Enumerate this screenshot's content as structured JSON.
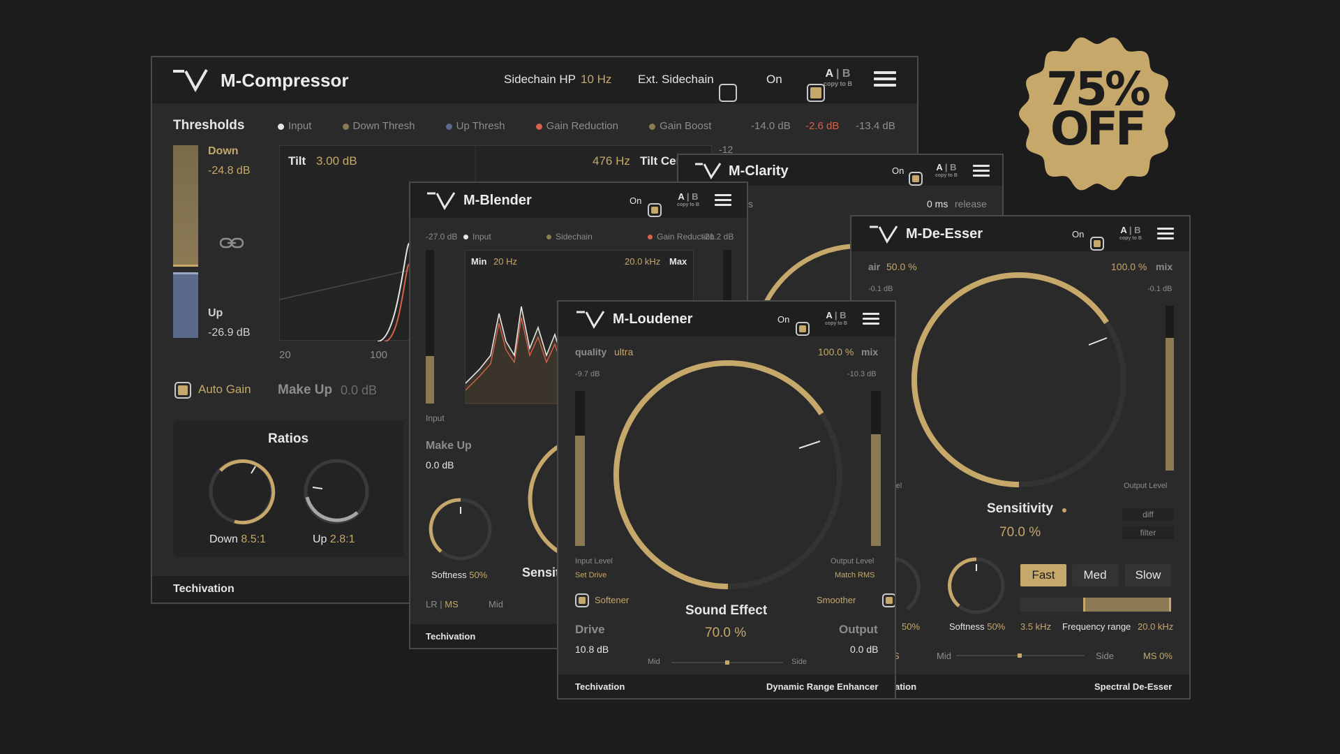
{
  "colors": {
    "accent": "#c6a86b",
    "background": "#1c1c1c",
    "panel": "#2a2a2a",
    "gain_reduction": "#d7624c",
    "up_threshold": "#5a6a8a"
  },
  "badge": {
    "line1": "75%",
    "line2": "OFF"
  },
  "compressor": {
    "title": "M-Compressor",
    "sidechain_hp_label": "Sidechain HP",
    "sidechain_hp_value": "10 Hz",
    "ext_sidechain_label": "Ext. Sidechain",
    "on_label": "On",
    "ab": {
      "a": "A",
      "sep": "|",
      "b": "B",
      "copy": "copy to B"
    },
    "thresholds_label": "Thresholds",
    "legend": {
      "input": "Input",
      "down_thresh": "Down Thresh",
      "up_thresh": "Up Thresh",
      "gain_reduction": "Gain Reduction",
      "gain_boost": "Gain Boost"
    },
    "readouts": {
      "v1": "-14.0 dB",
      "v2": "-2.6 dB",
      "v3": "-13.4 dB"
    },
    "down_label": "Down",
    "down_value": "-24.8 dB",
    "up_label": "Up",
    "up_value": "-26.9 dB",
    "tilt_label": "Tilt",
    "tilt_value": "3.00 dB",
    "tilt_freq": "476 Hz",
    "tilt_center": "Tilt Cen",
    "axis_minus12": "-12",
    "axis_20": "20",
    "axis_100": "100",
    "auto_gain": "Auto Gain",
    "make_up_label": "Make Up",
    "make_up_value": "0.0 dB",
    "ratios_label": "Ratios",
    "ratio_down_label": "Down",
    "ratio_down_value": "8.5:1",
    "ratio_up_label": "Up",
    "ratio_up_value": "2.8:1",
    "footer": "Techivation"
  },
  "blender": {
    "title": "M-Blender",
    "on_label": "On",
    "ab": {
      "a": "A",
      "sep": "|",
      "b": "B",
      "copy": "copy to B"
    },
    "left_db": "-27.0 dB",
    "legend_input": "Input",
    "legend_sidechain": "Sidechain",
    "legend_gain_reduction": "Gain Reduction",
    "right_db": "-21.2 dB",
    "min_label": "Min",
    "min_value": "20 Hz",
    "max_value": "20.0 kHz",
    "max_label": "Max",
    "input_label": "Input",
    "make_up_label": "Make Up",
    "make_up_value": "0.0 dB",
    "softness_label": "Softness",
    "softness_value": "50%",
    "sensitivity_partial": "Sensit",
    "lr": "LR",
    "ms": "MS",
    "mid": "Mid",
    "footer": "Techivation"
  },
  "clarity": {
    "title": "M-Clarity",
    "on_label": "On",
    "ab": {
      "a": "A",
      "sep": "|",
      "b": "B",
      "copy": "copy to B"
    },
    "s_partial": "s",
    "release_value": "0 ms",
    "release_label": "release"
  },
  "deesser": {
    "title": "M-De-Esser",
    "on_label": "On",
    "ab": {
      "a": "A",
      "sep": "|",
      "b": "B",
      "copy": "copy to B"
    },
    "air_label": "air",
    "air_value": "50.0 %",
    "mix_value": "100.0 %",
    "mix_label": "mix",
    "left_db": "-0.1 dB",
    "right_db": "-0.1 dB",
    "level_partial": "evel",
    "output_level": "Output Level",
    "sensitivity_label": "Sensitivity",
    "sensitivity_value": "70.0 %",
    "sensitivity_level": 0.7,
    "diff": "diff",
    "filter": "filter",
    "fast": "Fast",
    "med": "Med",
    "slow": "Slow",
    "th_partial": "th",
    "th_value": "50%",
    "softness_label": "Softness",
    "softness_value": "50%",
    "freq_low": "3.5 kHz",
    "freq_range_label": "Frequency range",
    "freq_high": "20.0 kHz",
    "s_partial": "S",
    "mid": "Mid",
    "side": "Side",
    "ms_value": "MS 0%",
    "footer_partial": "ation",
    "footer_right": "Spectral De-Esser"
  },
  "loudener": {
    "title": "M-Loudener",
    "on_label": "On",
    "ab": {
      "a": "A",
      "sep": "|",
      "b": "B",
      "copy": "copy to B"
    },
    "quality_label": "quality",
    "quality_value": "ultra",
    "mix_value": "100.0 %",
    "mix_label": "mix",
    "left_db": "-9.7 dB",
    "right_db": "-10.3 dB",
    "input_level": "Input Level",
    "set_drive": "Set Drive",
    "output_level": "Output Level",
    "match_rms": "Match RMS",
    "softener": "Softener",
    "smoother": "Smoother",
    "sound_effect_label": "Sound Effect",
    "sound_effect_value": "70.0 %",
    "sound_effect_level": 0.7,
    "drive_label": "Drive",
    "drive_value": "10.8 dB",
    "output_label": "Output",
    "output_value": "0.0 dB",
    "mid": "Mid",
    "side": "Side",
    "footer_left": "Techivation",
    "footer_right": "Dynamic Range Enhancer"
  }
}
